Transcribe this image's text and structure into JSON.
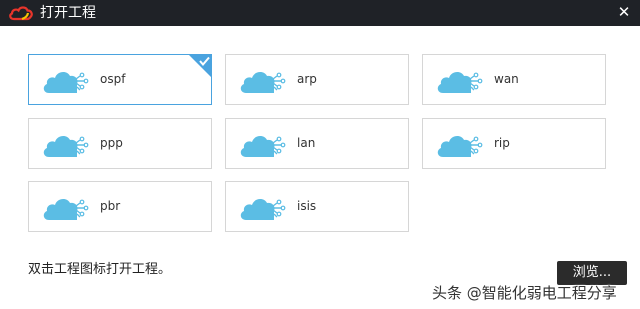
{
  "window": {
    "title": "打开工程",
    "close_glyph": "✕"
  },
  "projects": [
    {
      "label": "ospf",
      "selected": true
    },
    {
      "label": "arp",
      "selected": false
    },
    {
      "label": "wan",
      "selected": false
    },
    {
      "label": "ppp",
      "selected": false
    },
    {
      "label": "lan",
      "selected": false
    },
    {
      "label": "rip",
      "selected": false
    },
    {
      "label": "pbr",
      "selected": false
    },
    {
      "label": "isis",
      "selected": false
    }
  ],
  "hint": "双击工程图标打开工程。",
  "browse_label": "浏览...",
  "watermark": "头条 @智能化弱电工程分享",
  "colors": {
    "cloud": "#5bbde4",
    "accent": "#4aa3df",
    "titlebar": "#1f2227",
    "logo_red": "#e8352b",
    "logo_yellow": "#f5c400"
  },
  "icons": {
    "project": "cloud-network-icon",
    "logo": "cloud-logo-icon",
    "check": "checkmark-icon"
  }
}
